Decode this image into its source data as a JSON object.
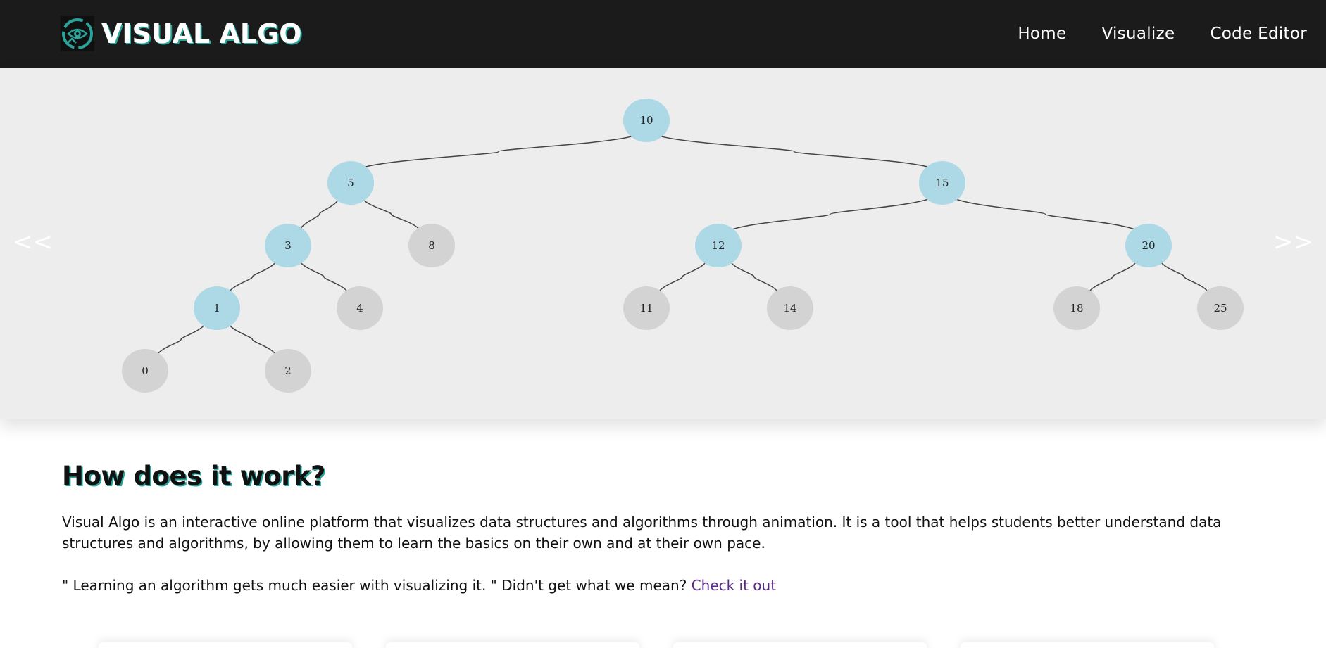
{
  "header": {
    "brand": "VISUAL ALGO",
    "logo_icon": "eye-icon",
    "nav": [
      {
        "label": "Home"
      },
      {
        "label": "Visualize"
      },
      {
        "label": "Code Editor"
      }
    ]
  },
  "hero": {
    "prev_label": "<<",
    "next_label": ">>",
    "tree": {
      "nodes": [
        {
          "id": "n10",
          "label": "10",
          "highlighted": true
        },
        {
          "id": "n5",
          "label": "5",
          "highlighted": true
        },
        {
          "id": "n15",
          "label": "15",
          "highlighted": true
        },
        {
          "id": "n3",
          "label": "3",
          "highlighted": true
        },
        {
          "id": "n8",
          "label": "8",
          "highlighted": false
        },
        {
          "id": "n12",
          "label": "12",
          "highlighted": true
        },
        {
          "id": "n20",
          "label": "20",
          "highlighted": true
        },
        {
          "id": "n1",
          "label": "1",
          "highlighted": true
        },
        {
          "id": "n4",
          "label": "4",
          "highlighted": false
        },
        {
          "id": "n11",
          "label": "11",
          "highlighted": false
        },
        {
          "id": "n14",
          "label": "14",
          "highlighted": false
        },
        {
          "id": "n18",
          "label": "18",
          "highlighted": false
        },
        {
          "id": "n25",
          "label": "25",
          "highlighted": false
        },
        {
          "id": "n0",
          "label": "0",
          "highlighted": false
        },
        {
          "id": "n2",
          "label": "2",
          "highlighted": false
        }
      ],
      "edges": [
        [
          "n10",
          "n5"
        ],
        [
          "n10",
          "n15"
        ],
        [
          "n5",
          "n3"
        ],
        [
          "n5",
          "n8"
        ],
        [
          "n15",
          "n12"
        ],
        [
          "n15",
          "n20"
        ],
        [
          "n3",
          "n1"
        ],
        [
          "n3",
          "n4"
        ],
        [
          "n12",
          "n11"
        ],
        [
          "n12",
          "n14"
        ],
        [
          "n20",
          "n18"
        ],
        [
          "n20",
          "n25"
        ],
        [
          "n1",
          "n0"
        ],
        [
          "n1",
          "n2"
        ]
      ],
      "colors": {
        "highlighted": "#add8e6",
        "default": "#d3d3d3",
        "edge": "#444444"
      }
    }
  },
  "main": {
    "title": "How does it work?",
    "paragraph": "Visual Algo is an interactive online platform that visualizes data structures and algorithms through animation. It is a tool that helps students better understand data structures and algorithms, by allowing them to learn the basics on their own and at their own pace.",
    "quote": "\" Learning an algorithm gets much easier with visualizing it. \" Didn't get what we mean? ",
    "link_label": "Check it out"
  }
}
